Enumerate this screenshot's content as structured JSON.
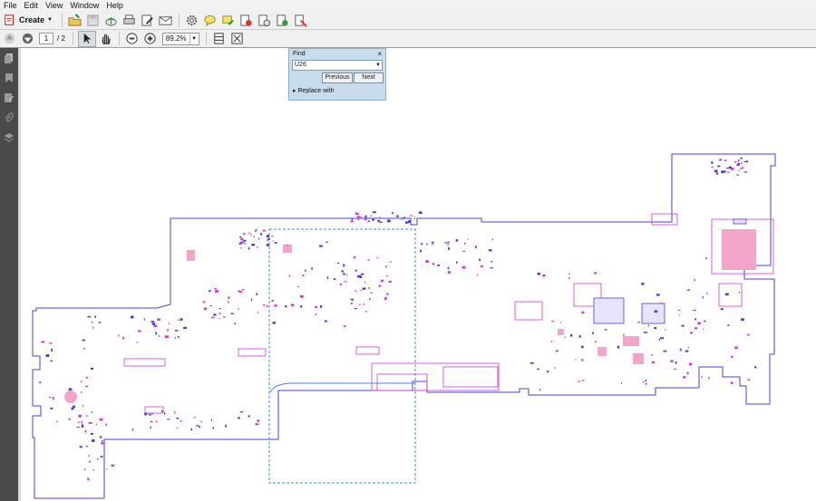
{
  "menu": [
    "File",
    "Edit",
    "View",
    "Window",
    "Help"
  ],
  "toolbar": {
    "create_label": "Create"
  },
  "nav": {
    "current_page": "1",
    "page_total": "/ 2",
    "zoom": "89,2%"
  },
  "find": {
    "title": "Find",
    "query": "U26",
    "previous_label": "Previous",
    "next_label": "Next",
    "replace_label": "Replace with"
  },
  "colors": {
    "board_outline": "#4a3fd8",
    "part": "#d23ad6",
    "pad": "#f2a4c9",
    "selection": "#3a8be0"
  }
}
